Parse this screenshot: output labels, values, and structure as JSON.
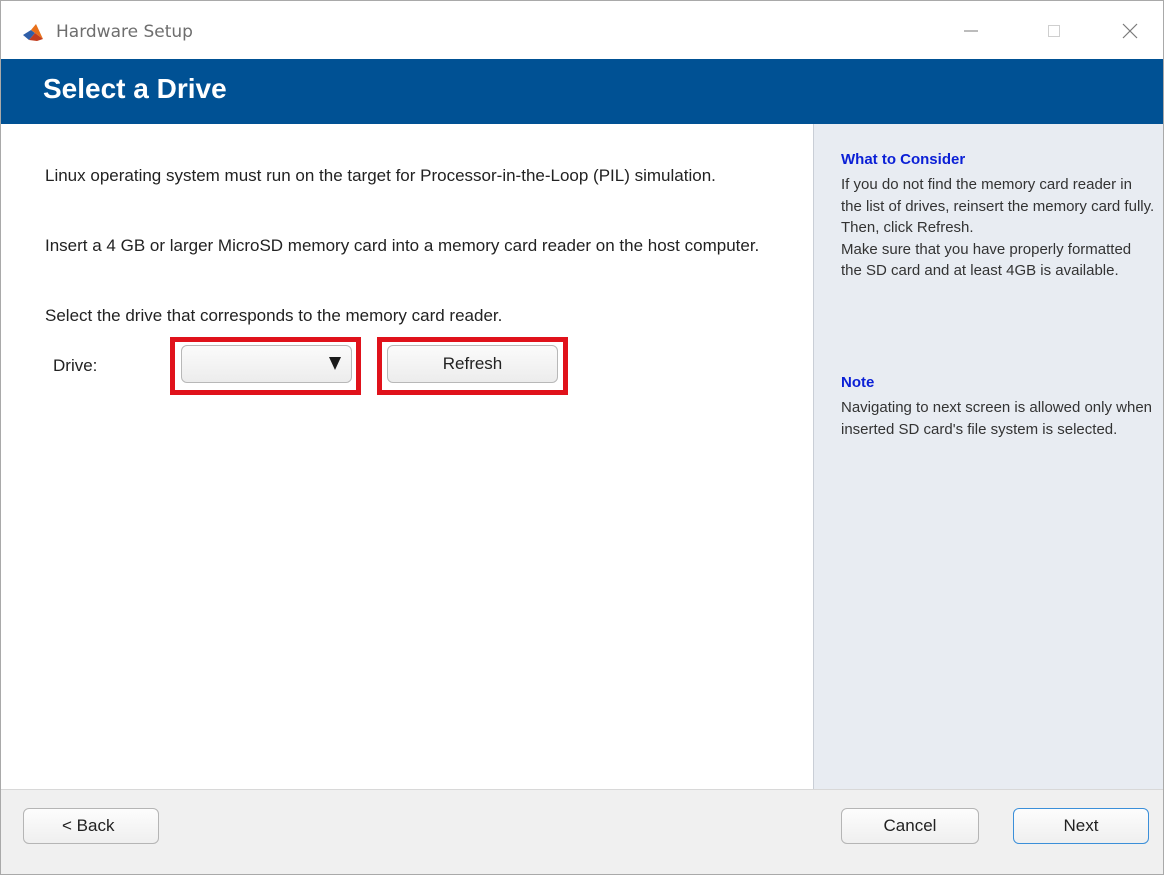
{
  "window": {
    "title": "Hardware Setup",
    "controls": {
      "minimize": "minimize-icon",
      "maximize": "maximize-icon",
      "close": "close-icon"
    },
    "app_icon": "matlab-logo-icon"
  },
  "header": {
    "title": "Select a Drive"
  },
  "main": {
    "paragraphs": [
      "Linux operating system must run on the target for  Processor-in-the-Loop (PIL) simulation.",
      "Insert a 4 GB or larger MicroSD memory card into a memory card reader on the host computer.",
      "Select the drive that corresponds to the memory card reader."
    ],
    "drive_label": "Drive:",
    "drive_value": "",
    "refresh_label": "Refresh"
  },
  "help": {
    "sections": [
      {
        "heading": "What to Consider",
        "text": "If you do not find the memory card reader in the list of drives, reinsert the memory card fully. Then, click Refresh.\nMake sure that you have properly formatted the SD card and at least 4GB is available."
      },
      {
        "heading": "Note",
        "text": "Navigating to next screen is allowed only when inserted SD card's file system is selected."
      }
    ]
  },
  "footer": {
    "back_label": "< Back",
    "cancel_label": "Cancel",
    "next_label": "Next"
  },
  "colors": {
    "banner": "#005194",
    "help_heading": "#0a1fd6",
    "highlight": "#e0121b",
    "help_panel": "#e8ecf2"
  }
}
